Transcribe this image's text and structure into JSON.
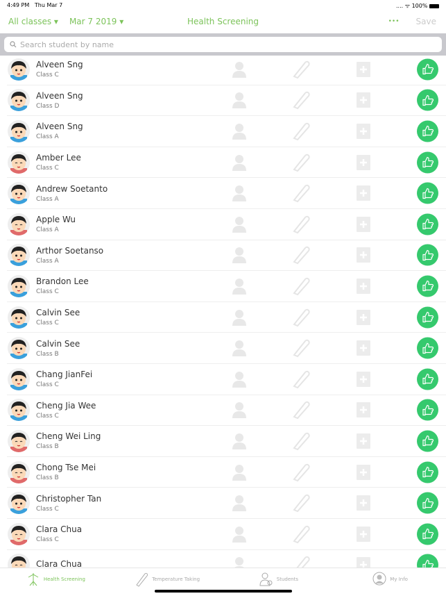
{
  "status": {
    "time": "4:49 PM",
    "date": "Thu Mar 7",
    "battery": "100%"
  },
  "nav": {
    "class_filter": "All classes ▾",
    "date_filter": "Mar 7 2019 ▾",
    "title": "Health Screening",
    "more": "•••",
    "save": "Save"
  },
  "search": {
    "placeholder": "Search student by name"
  },
  "colors": {
    "accent": "#7cc35a",
    "thumb": "#35c96d"
  },
  "students": [
    {
      "name": "Alveen Sng",
      "class": "Class C",
      "avatar": "boy"
    },
    {
      "name": "Alveen Sng",
      "class": "Class D",
      "avatar": "boy"
    },
    {
      "name": "Alveen Sng",
      "class": "Class A",
      "avatar": "boy"
    },
    {
      "name": "Amber Lee",
      "class": "Class C",
      "avatar": "girl"
    },
    {
      "name": "Andrew Soetanto",
      "class": "Class A",
      "avatar": "boy"
    },
    {
      "name": "Apple Wu",
      "class": "Class A",
      "avatar": "girl"
    },
    {
      "name": "Arthor Soetanso",
      "class": "Class A",
      "avatar": "boy"
    },
    {
      "name": "Brandon Lee",
      "class": "Class C",
      "avatar": "boy"
    },
    {
      "name": "Calvin See",
      "class": "Class C",
      "avatar": "boy"
    },
    {
      "name": "Calvin See",
      "class": "Class B",
      "avatar": "boy"
    },
    {
      "name": "Chang JianFei",
      "class": "Class C",
      "avatar": "boy"
    },
    {
      "name": "Cheng Jia Wee",
      "class": "Class C",
      "avatar": "boy"
    },
    {
      "name": "Cheng Wei Ling",
      "class": "Class B",
      "avatar": "girl"
    },
    {
      "name": "Chong Tse Mei",
      "class": "Class B",
      "avatar": "girl"
    },
    {
      "name": "Christopher Tan",
      "class": "Class C",
      "avatar": "boy"
    },
    {
      "name": "Clara Chua",
      "class": "Class C",
      "avatar": "girl"
    },
    {
      "name": "Clara Chua",
      "class": "",
      "avatar": "girl"
    }
  ],
  "tabs": [
    {
      "label": "Health Screening",
      "icon": "health-screening-icon",
      "active": true
    },
    {
      "label": "Temperature Taking",
      "icon": "thermometer-icon"
    },
    {
      "label": "Students",
      "icon": "students-icon"
    },
    {
      "label": "My Info",
      "icon": "user-icon"
    }
  ]
}
